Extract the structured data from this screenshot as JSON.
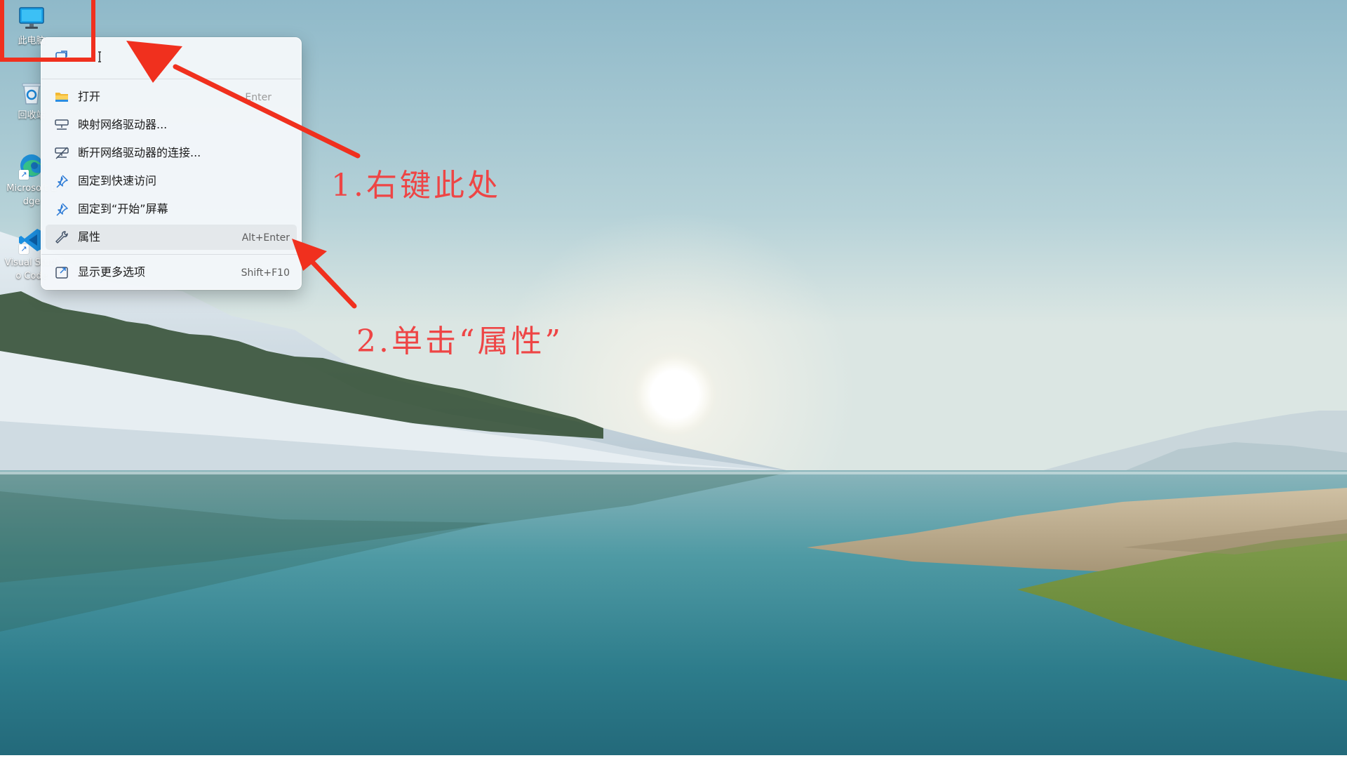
{
  "desktop": {
    "icons": [
      {
        "id": "this-pc",
        "label": "此电脑",
        "icon": "monitor-icon"
      },
      {
        "id": "recycle-bin",
        "label": "回收站",
        "icon": "recycle-bin-icon"
      },
      {
        "id": "edge",
        "label": "Microsoft Edge",
        "icon": "edge-icon"
      },
      {
        "id": "vscode",
        "label": "Visual Studio Code",
        "icon": "vscode-icon"
      }
    ]
  },
  "context_menu": {
    "top_actions": [
      {
        "name": "open-icon-action",
        "icon": "open-action-icon"
      },
      {
        "name": "rename-icon-action",
        "icon": "rename-action-icon"
      }
    ],
    "items": [
      {
        "label": "打开",
        "shortcut": "Enter",
        "icon": "folder-icon"
      },
      {
        "label": "映射网络驱动器...",
        "shortcut": "",
        "icon": "map-network-drive-icon"
      },
      {
        "label": "断开网络驱动器的连接...",
        "shortcut": "",
        "icon": "disconnect-network-drive-icon"
      },
      {
        "label": "固定到快速访问",
        "shortcut": "",
        "icon": "pin-icon"
      },
      {
        "label": "固定到“开始”屏幕",
        "shortcut": "",
        "icon": "pin-icon"
      },
      {
        "label": "属性",
        "shortcut": "Alt+Enter",
        "icon": "wrench-icon"
      },
      {
        "label": "显示更多选项",
        "shortcut": "Shift+F10",
        "icon": "more-options-icon"
      }
    ]
  },
  "annotations": {
    "step1": "1.右键此处",
    "step2": "2.单击“属性”"
  },
  "colors": {
    "annotation": "#ee4545",
    "highlight": "#f0301e",
    "menu_bg": "#f4f7fa"
  }
}
